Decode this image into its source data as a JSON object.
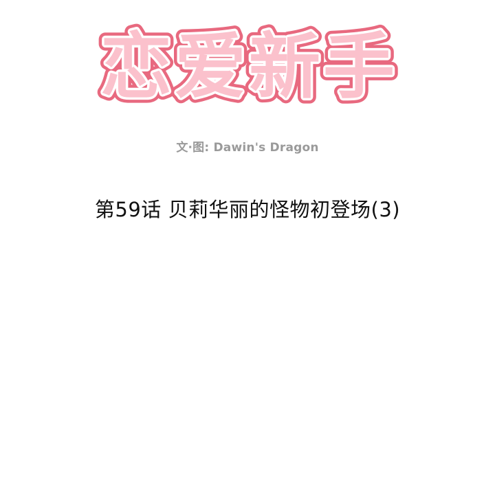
{
  "series_title": "恋爱新手",
  "credit": "文·图: Dawin's Dragon",
  "episode_title": "第59话 贝莉华丽的怪物初登场(3)",
  "colors": {
    "title_fill": "#fbc1cc",
    "title_stroke": "#e8697f",
    "title_outline": "#ffffff",
    "credit_text": "#9a9a9a",
    "episode_text": "#111111",
    "background": "#ffffff"
  }
}
